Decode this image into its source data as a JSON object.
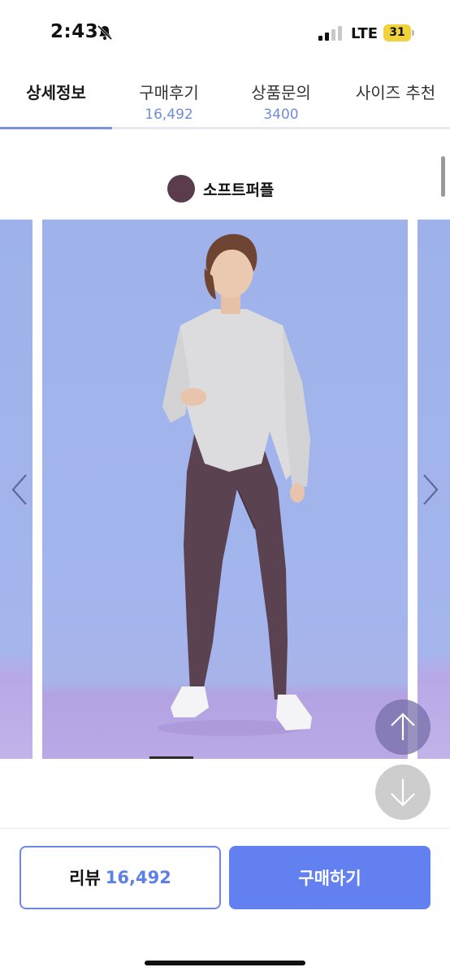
{
  "status_bar": {
    "time": "2:43",
    "network": "LTE",
    "battery": "31"
  },
  "tabs": [
    {
      "label": "상세정보",
      "count": "",
      "active": true
    },
    {
      "label": "구매후기",
      "count": "16,492",
      "active": false
    },
    {
      "label": "상품문의",
      "count": "3400",
      "active": false
    },
    {
      "label": "사이즈 추천",
      "count": "",
      "active": false
    }
  ],
  "product": {
    "color_name": "소프트퍼플",
    "color_swatch": "#5a3c4d"
  },
  "bottom_bar": {
    "review_label": "리뷰",
    "review_count": "16,492",
    "buy_label": "구매하기"
  },
  "colors": {
    "accent": "#6280ef",
    "tab_count": "#6f8ddb",
    "backdrop": "#a3b5ec"
  }
}
